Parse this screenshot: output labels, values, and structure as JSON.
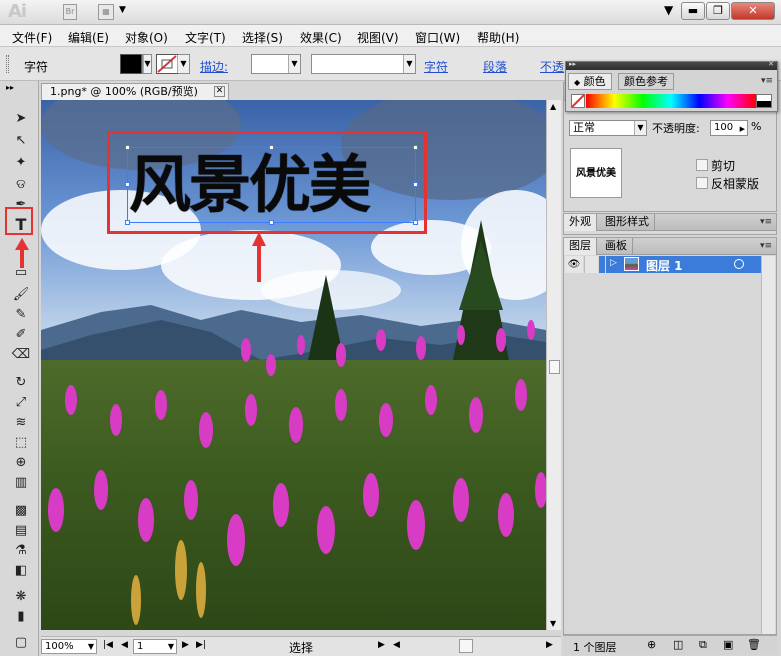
{
  "app": {
    "logo": "Ai",
    "titlebar_icon_br": "Br"
  },
  "window_buttons": {
    "minimize": "▬",
    "restore": "❐",
    "close": "✕"
  },
  "menu": [
    "文件(F)",
    "编辑(E)",
    "对象(O)",
    "文字(T)",
    "选择(S)",
    "效果(C)",
    "视图(V)",
    "窗口(W)",
    "帮助(H)"
  ],
  "controlbar": {
    "mode_label": "字符",
    "stroke_label": "描边:",
    "char_link": "字符",
    "para_link": "段落",
    "opacity_link": "不透"
  },
  "document": {
    "tab_title": "1.png* @ 100% (RGB/预览)",
    "headline": "风景优美"
  },
  "status": {
    "zoom": "100%",
    "page": "1",
    "mode": "选择"
  },
  "color_panel": {
    "tab_color": "颜色",
    "tab_guide": "颜色参考"
  },
  "transparency_panel": {
    "blend_mode": "正常",
    "opacity_label": "不透明度:",
    "opacity_value": "100",
    "opacity_unit": "%",
    "thumb_text": "风景优美",
    "clip_label": "剪切",
    "invert_label": "反相蒙版"
  },
  "appearance_panel": {
    "tab_appearance": "外观",
    "tab_styles": "图形样式"
  },
  "layers_panel": {
    "tab_layers": "图层",
    "tab_artboards": "画板",
    "layer_name": "图层 1",
    "layer_count": "1 个图层"
  },
  "colors": {
    "accent_red": "#e53232",
    "selection_blue": "#3a7bff",
    "layer_highlight": "#3b7bd9"
  }
}
